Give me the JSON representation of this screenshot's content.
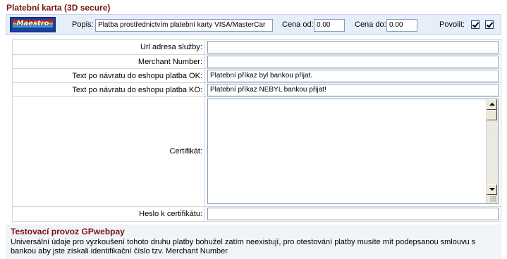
{
  "section": {
    "title": "Platební karta (3D secure)"
  },
  "topbar": {
    "logo_text": "Maestro",
    "popis_label": "Popis:",
    "popis_value": "Platba prostřednictvím platební karty VISA/MasterCar",
    "cena_od_label": "Cena od:",
    "cena_od_value": "0.00",
    "cena_do_label": "Cena do:",
    "cena_do_value": "0.00",
    "povolit_label": "Povolit:",
    "checkbox1_checked": true,
    "checkbox2_checked": true
  },
  "form": {
    "rows": [
      {
        "label": "Url adresa služby:",
        "value": ""
      },
      {
        "label": "Merchant Number:",
        "value": ""
      },
      {
        "label": "Text po návratu do eshopu platba OK:",
        "value": "Platební příkaz byl bankou přijat."
      },
      {
        "label": "Text po návratu do eshopu platba KO:",
        "value": "Platební příkaz NEBYL bankou přijat!"
      },
      {
        "label": "Certifikát:",
        "value": ""
      },
      {
        "label": "Heslo k certifikátu:",
        "value": ""
      }
    ]
  },
  "note": {
    "title": "Testovací provoz GPwebpay",
    "text": "Universální údaje pro vyzkoušení tohoto druhu platby bohužel zatím neexistují, pro otestování platby musíte mít podepsanou smlouvu s bankou aby jste získali identifikační číslo tzv. Merchant Number"
  }
}
